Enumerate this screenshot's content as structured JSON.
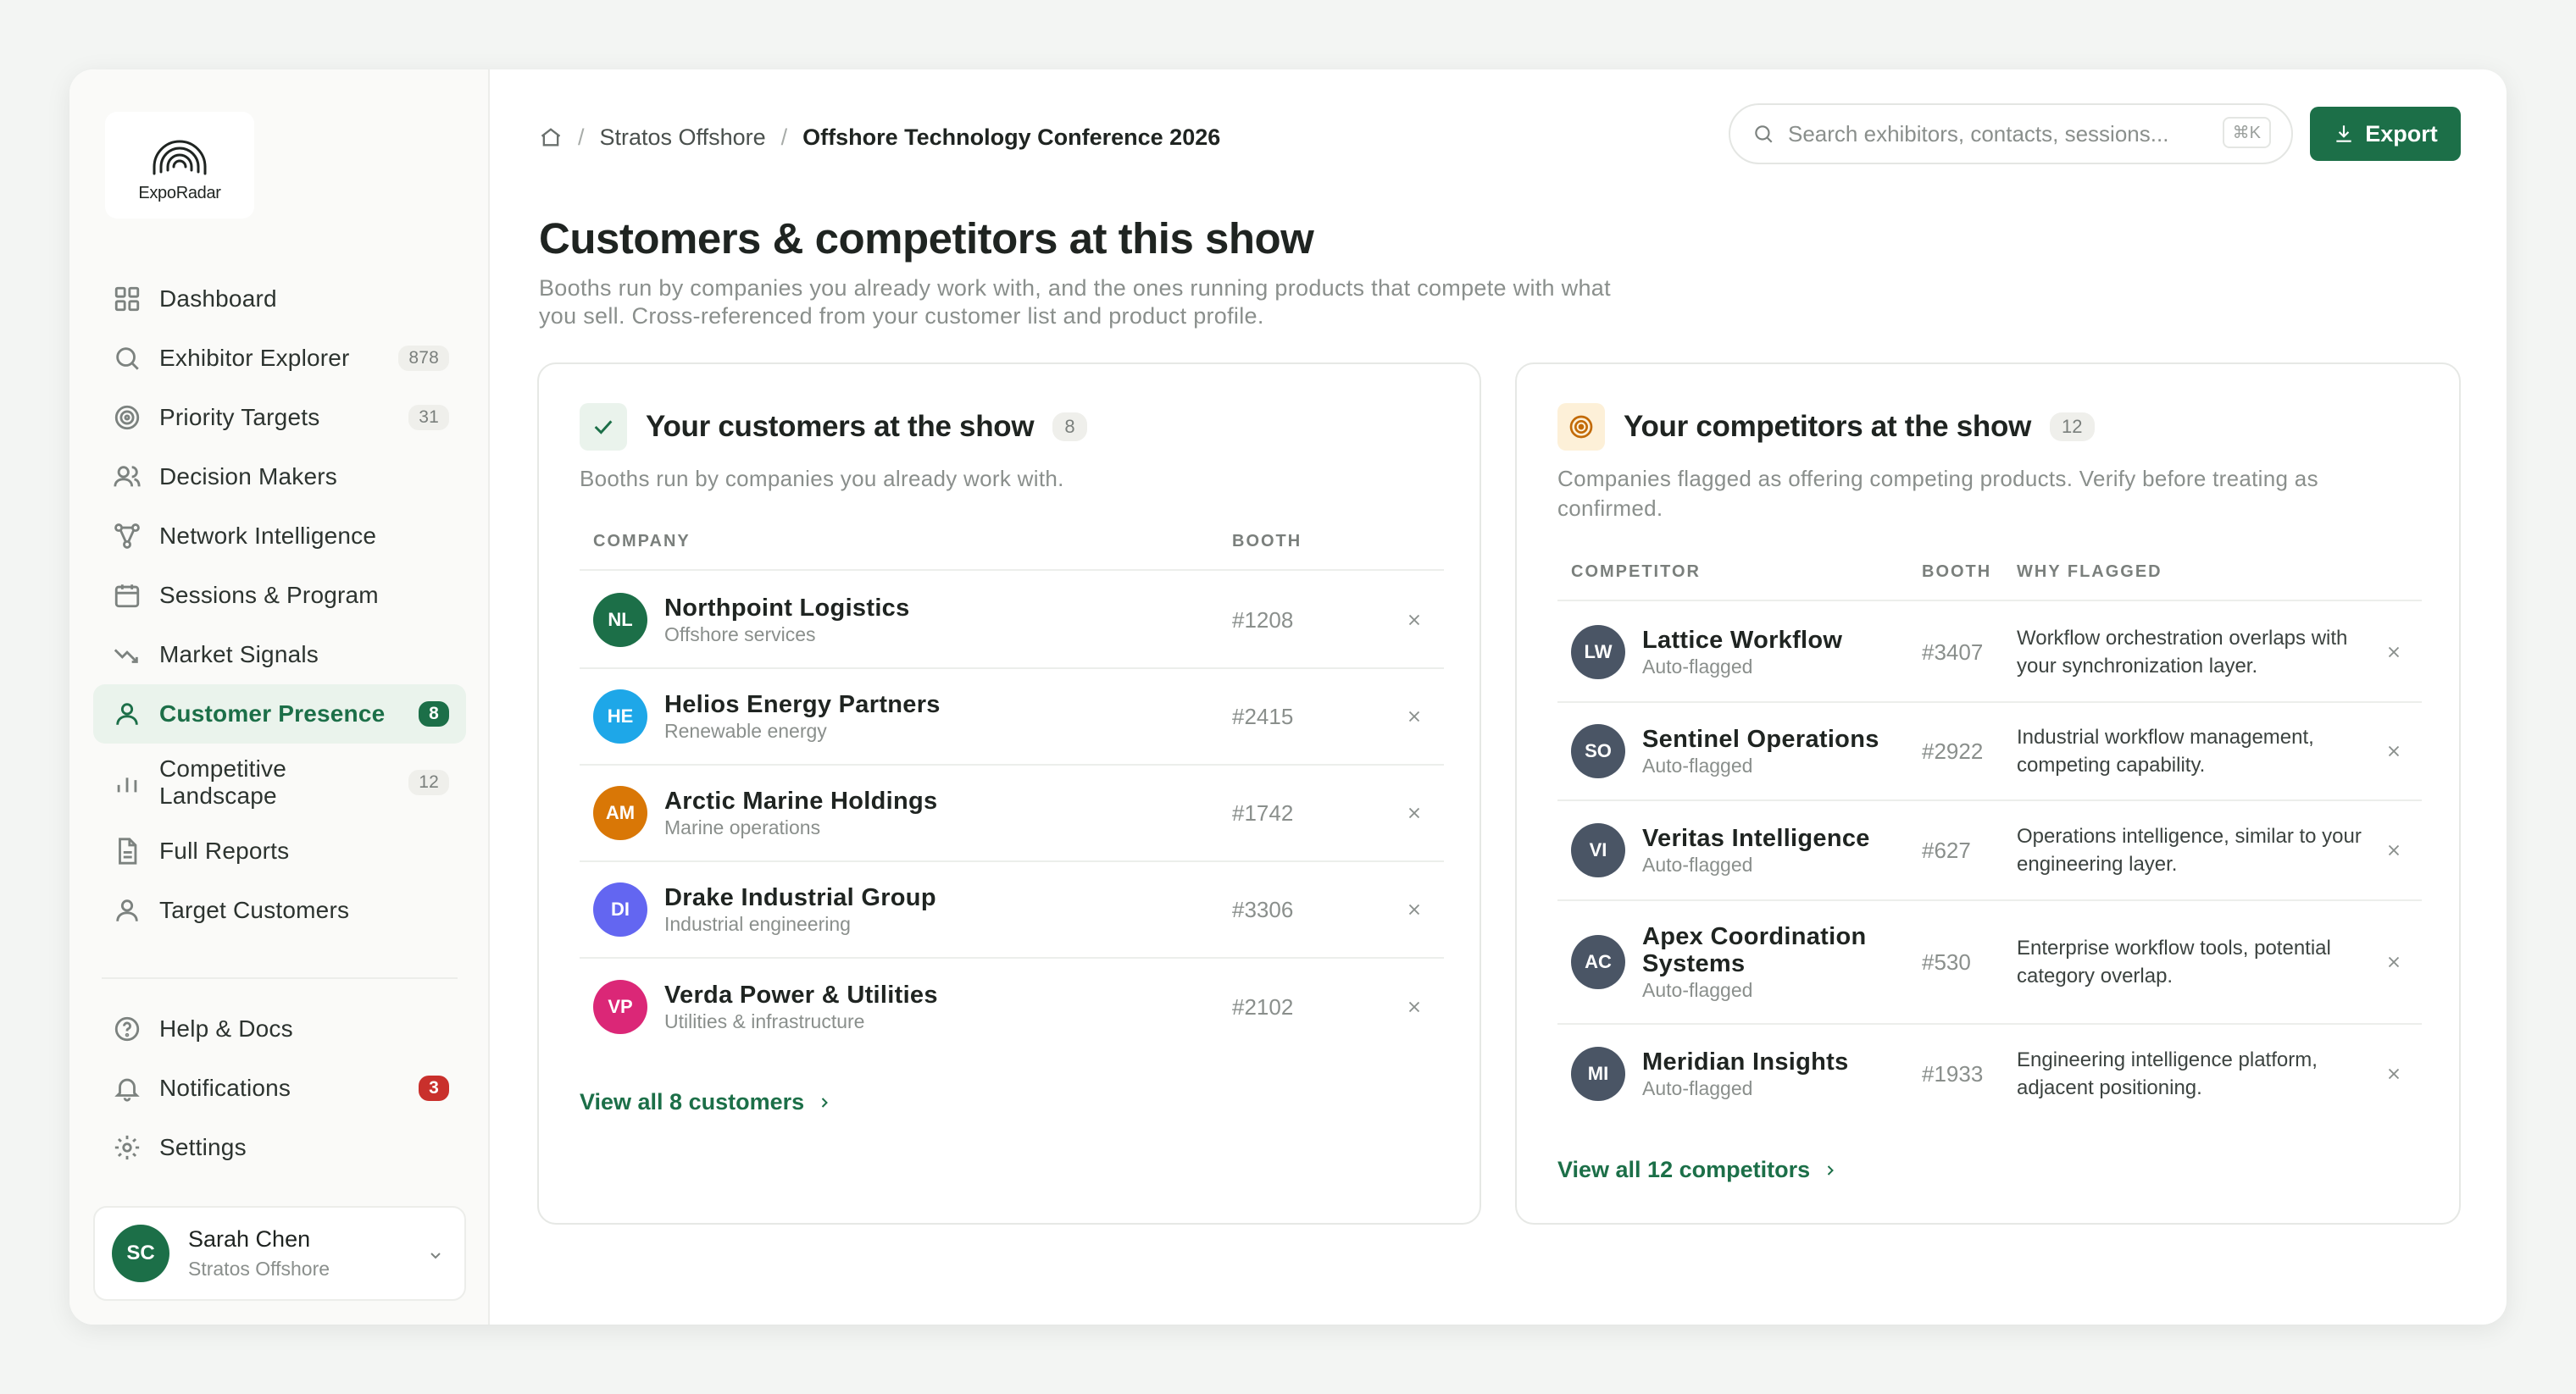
{
  "app": {
    "logo_text": "ExpoRadar"
  },
  "sidebar": {
    "items": [
      {
        "label": "Dashboard",
        "icon": "grid-icon"
      },
      {
        "label": "Exhibitor Explorer",
        "icon": "search-icon",
        "badge": "878"
      },
      {
        "label": "Priority Targets",
        "icon": "target-icon",
        "badge": "31"
      },
      {
        "label": "Decision Makers",
        "icon": "users-icon"
      },
      {
        "label": "Network Intelligence",
        "icon": "network-icon"
      },
      {
        "label": "Sessions & Program",
        "icon": "calendar-icon"
      },
      {
        "label": "Market Signals",
        "icon": "trend-icon"
      },
      {
        "label": "Customer Presence",
        "icon": "user-icon",
        "badge": "8",
        "active": true
      },
      {
        "label": "Competitive Landscape",
        "icon": "bar-chart-icon",
        "badge": "12"
      },
      {
        "label": "Full Reports",
        "icon": "document-icon"
      },
      {
        "label": "Target Customers",
        "icon": "user-icon"
      }
    ],
    "footer_items": [
      {
        "label": "Help & Docs",
        "icon": "help-icon"
      },
      {
        "label": "Notifications",
        "icon": "bell-icon",
        "badge": "3"
      },
      {
        "label": "Settings",
        "icon": "gear-icon"
      }
    ],
    "user": {
      "initials": "SC",
      "name": "Sarah Chen",
      "org": "Stratos Offshore"
    }
  },
  "header": {
    "breadcrumb": [
      "Stratos Offshore",
      "Offshore Technology Conference 2026"
    ],
    "search_placeholder": "Search exhibitors, contacts, sessions...",
    "search_shortcut": "⌘K",
    "export_label": "Export"
  },
  "page": {
    "title": "Customers & competitors at this show",
    "subtitle": "Booths run by companies you already work with, and the ones running products that compete with what you sell. Cross-referenced from your customer list and product profile."
  },
  "customers": {
    "title": "Your customers at the show",
    "count": "8",
    "subtitle": "Booths run by companies you already work with.",
    "columns": [
      "COMPANY",
      "BOOTH"
    ],
    "rows": [
      {
        "initials": "NL",
        "name": "Northpoint Logistics",
        "sector": "Offshore services",
        "booth": "#1208",
        "color": "#1c6f48"
      },
      {
        "initials": "HE",
        "name": "Helios Energy Partners",
        "sector": "Renewable energy",
        "booth": "#2415",
        "color": "#1ea7e8"
      },
      {
        "initials": "AM",
        "name": "Arctic Marine Holdings",
        "sector": "Marine operations",
        "booth": "#1742",
        "color": "#d97706"
      },
      {
        "initials": "DI",
        "name": "Drake Industrial Group",
        "sector": "Industrial engineering",
        "booth": "#3306",
        "color": "#6366f1"
      },
      {
        "initials": "VP",
        "name": "Verda Power & Utilities",
        "sector": "Utilities & infrastructure",
        "booth": "#2102",
        "color": "#db2777"
      }
    ],
    "view_all": "View all 8 customers"
  },
  "competitors": {
    "title": "Your competitors at the show",
    "count": "12",
    "subtitle_line1": "Companies flagged as offering competing products. Verify before treating as",
    "subtitle_line2": "confirmed.",
    "columns": [
      "COMPETITOR",
      "BOOTH",
      "WHY FLAGGED"
    ],
    "rows": [
      {
        "initials": "LW",
        "name": "Lattice Workflow",
        "status": "Auto-flagged",
        "booth": "#3407",
        "why": "Workflow orchestration overlaps with your synchronization layer."
      },
      {
        "initials": "SO",
        "name": "Sentinel Operations",
        "status": "Auto-flagged",
        "booth": "#2922",
        "why": "Industrial workflow management, competing capability."
      },
      {
        "initials": "VI",
        "name": "Veritas Intelligence",
        "status": "Auto-flagged",
        "booth": "#627",
        "why": "Operations intelligence, similar to your engineering layer."
      },
      {
        "initials": "AC",
        "name": "Apex Coordination Systems",
        "status": "Auto-flagged",
        "booth": "#530",
        "why": "Enterprise workflow tools, potential category overlap."
      },
      {
        "initials": "MI",
        "name": "Meridian Insights",
        "status": "Auto-flagged",
        "booth": "#1933",
        "why": "Engineering intelligence platform, adjacent positioning."
      }
    ],
    "avatar_color": "#4a5565",
    "view_all": "View all 12 competitors"
  },
  "colors": {
    "accent": "#1c6f48",
    "alert": "#c9302c"
  }
}
